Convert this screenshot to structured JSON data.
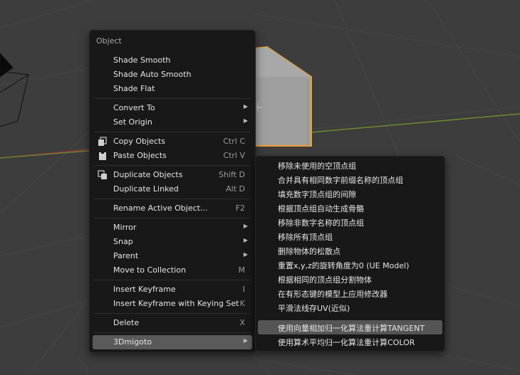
{
  "viewport": {
    "background": "#3d3d3d",
    "cube_color": "#9f9f9f",
    "selection_outline": "#f29e2f",
    "x_axis_color": "#8f3a3a",
    "y_axis_color": "#6f8a2e"
  },
  "object_menu": {
    "title": "Object",
    "items": [
      {
        "label": "Shade Smooth"
      },
      {
        "label": "Shade Auto Smooth"
      },
      {
        "label": "Shade Flat"
      },
      {
        "label": "Convert To",
        "submenu": true
      },
      {
        "label": "Set Origin",
        "submenu": true
      },
      {
        "label": "Copy Objects",
        "shortcut": "Ctrl C",
        "icon": "copy-icon"
      },
      {
        "label": "Paste Objects",
        "shortcut": "Ctrl V",
        "icon": "paste-icon"
      },
      {
        "label": "Duplicate Objects",
        "shortcut": "Shift D",
        "icon": "duplicate-icon"
      },
      {
        "label": "Duplicate Linked",
        "shortcut": "Alt D"
      },
      {
        "label": "Rename Active Object...",
        "shortcut": "F2"
      },
      {
        "label": "Mirror",
        "submenu": true
      },
      {
        "label": "Snap",
        "submenu": true
      },
      {
        "label": "Parent",
        "submenu": true
      },
      {
        "label": "Move to Collection",
        "shortcut": "M"
      },
      {
        "label": "Insert Keyframe",
        "shortcut": "I"
      },
      {
        "label": "Insert Keyframe with Keying Set",
        "shortcut": "K"
      },
      {
        "label": "Delete",
        "shortcut": "X"
      },
      {
        "label": "3Dmigoto",
        "submenu": true
      }
    ]
  },
  "submenu_3dmigoto": {
    "items": [
      "移除未使用的空顶点组",
      "合并具有相同数字前缀名称的顶点组",
      "填充数字顶点组的间隙",
      "根据顶点组自动生成骨骼",
      "移除非数字名称的顶点组",
      "移除所有顶点组",
      "删除物体的松散点",
      "重置x,y,z的旋转角度为0 (UE Model)",
      "根据相同的顶点组分割物体",
      "在有形态键的模型上应用修改器",
      "平滑法线存UV(近似)",
      "使用向量相加归一化算法重计算TANGENT",
      "使用算术平均归一化算法重计算COLOR"
    ],
    "highlighted_index": 11
  }
}
